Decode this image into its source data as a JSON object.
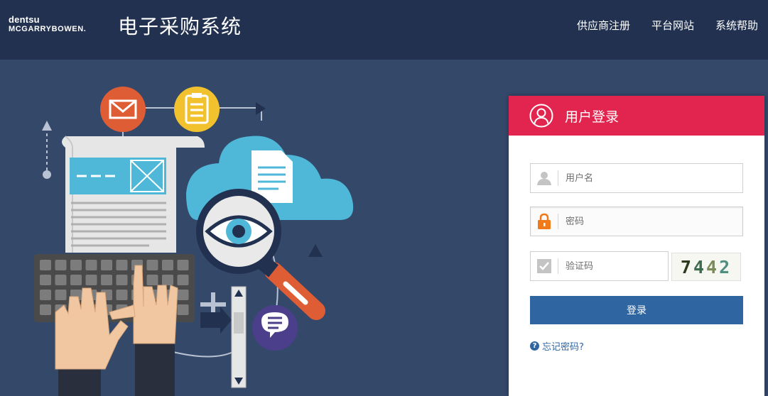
{
  "header": {
    "logo_line1": "dentsu",
    "logo_line2": "MCGARRYBOWEN.",
    "title": "电子采购系统",
    "nav": [
      "供应商注册",
      "平台网站",
      "系统帮助"
    ]
  },
  "login": {
    "title": "用户登录",
    "username_placeholder": "用户名",
    "password_placeholder": "密码",
    "captcha_placeholder": "验证码",
    "captcha_digits": [
      "7",
      "4",
      "4",
      "2"
    ],
    "captcha_colors": [
      "#2e3a1f",
      "#3c6b4e",
      "#7a8a5a",
      "#4f8f7f"
    ],
    "submit_label": "登录",
    "forgot_label": "忘记密码?"
  },
  "colors": {
    "header_bg": "#21314f",
    "page_bg": "#34486a",
    "login_header": "#e1254f",
    "primary_button": "#2f65a1"
  }
}
